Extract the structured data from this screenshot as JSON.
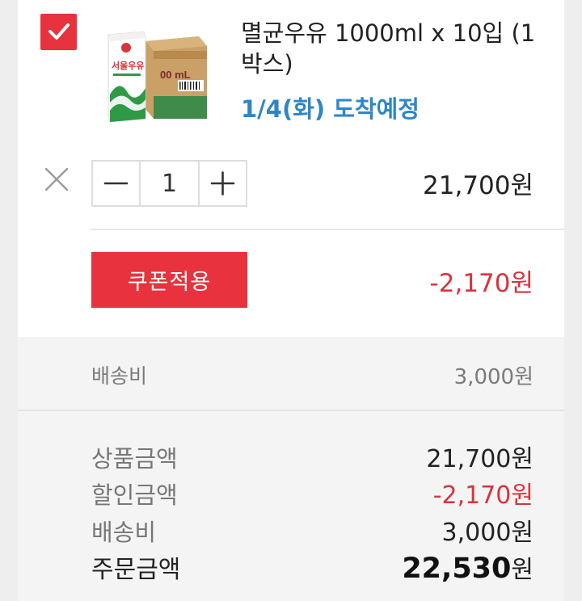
{
  "item": {
    "checked": true,
    "title": "멸균우유 1000ml x 10입 (1박스)",
    "delivery": "1/4(화) 도착예정",
    "brand_text": "서울우유",
    "package_text": "00 mL",
    "quantity": "1",
    "price": "21,700원",
    "coupon_button": "쿠폰적용",
    "coupon_discount": "-2,170원"
  },
  "shipping": {
    "label": "배송비",
    "value": "3,000원"
  },
  "summary": {
    "product_label": "상품금액",
    "product_value": "21,700원",
    "discount_label": "할인금액",
    "discount_value": "-2,170원",
    "shipping_label": "배송비",
    "shipping_value": "3,000원",
    "total_label": "주문금액",
    "total_value": "22,530",
    "total_unit": "원"
  },
  "colors": {
    "accent_red": "#e8323d",
    "delivery_blue": "#2f86c6"
  },
  "icons": {
    "check": "check-icon",
    "remove": "close-icon",
    "minus": "minus-icon",
    "plus": "plus-icon"
  }
}
